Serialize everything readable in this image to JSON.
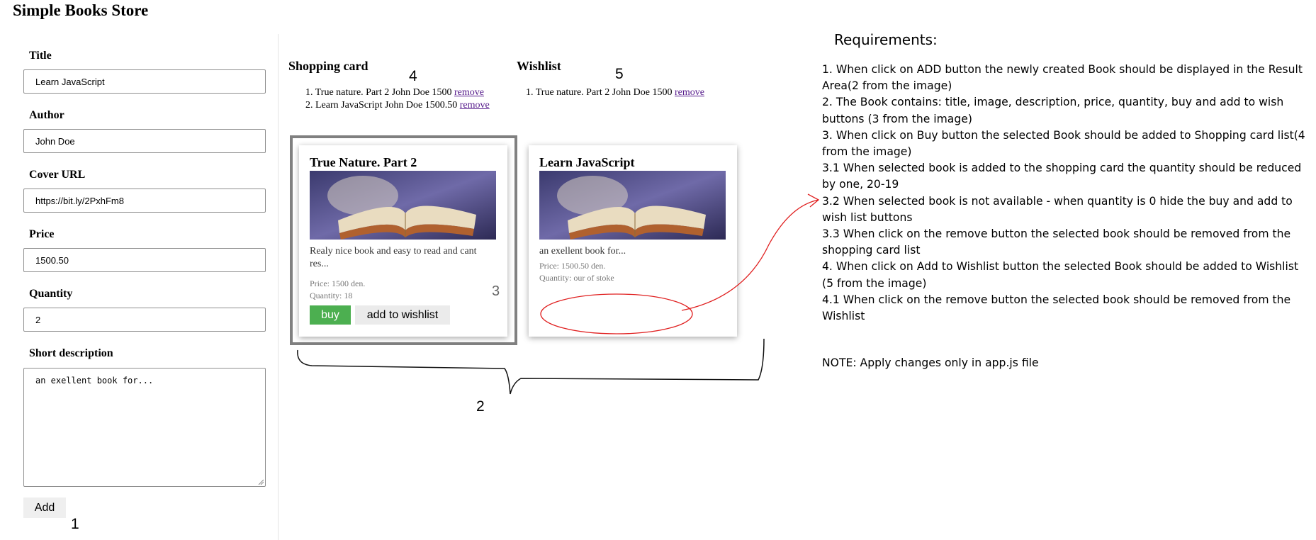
{
  "page": {
    "title": "Simple Books Store"
  },
  "form": {
    "title_label": "Title",
    "title_value": "Learn JavaScript",
    "author_label": "Author",
    "author_value": "John Doe",
    "cover_label": "Cover URL",
    "cover_value": "https://bit.ly/2PxhFm8",
    "price_label": "Price",
    "price_value": "1500.50",
    "quantity_label": "Quantity",
    "quantity_value": "2",
    "description_label": "Short description",
    "description_value": "an exellent book for...",
    "add_label": "Add"
  },
  "shopping_card": {
    "heading": "Shopping card",
    "items": [
      {
        "text": "True nature. Part 2 John Doe 1500",
        "remove_label": "remove"
      },
      {
        "text": "Learn JavaScript John Doe 1500.50",
        "remove_label": "remove"
      }
    ]
  },
  "wishlist": {
    "heading": "Wishlist",
    "items": [
      {
        "text": "True nature. Part 2 John Doe 1500",
        "remove_label": "remove"
      }
    ]
  },
  "books": [
    {
      "title": "True Nature. Part 2",
      "description": "Realy nice book and easy to read and cant res...",
      "price": "Price: 1500 den.",
      "quantity": "Quantity: 18",
      "buy_label": "buy",
      "wishlist_label": "add to wishlist"
    },
    {
      "title": "Learn JavaScript",
      "description": "an exellent book for...",
      "price": "Price: 1500.50 den.",
      "quantity": "Quantity: our of stoke"
    }
  ],
  "annotations": {
    "n1": "1",
    "n2": "2",
    "n3": "3",
    "n4": "4",
    "n5": "5"
  },
  "requirements": {
    "title": "Requirements:",
    "items": [
      "1. When click on ADD button the newly created Book should be displayed in the Result Area(2 from the image)",
      "2. The Book contains: title, image, description, price, quantity, buy and add to wish buttons (3 from the image)",
      "3. When click on Buy button the selected Book should be added to Shopping card list(4 from the image)",
      "3.1 When selected book is added to the shopping card the quantity should be reduced by one, 20-19",
      "3.2 When selected book is not available - when quantity is 0 hide the buy and add to wish list buttons",
      "3.3 When click on the remove button the selected book should be removed from the shopping card list",
      "4. When click on Add to Wishlist button the selected Book should be added to Wishlist (5 from the image)",
      "4.1 When click on the remove button the selected book should be removed from the Wishlist"
    ],
    "note": "NOTE: Apply changes only in app.js file"
  },
  "colors": {
    "buy_button": "#4caf50",
    "wishlist_button": "#ebebeb",
    "link": "#551a8b",
    "annotation_red": "#e02020",
    "highlight_border": "#808080"
  }
}
